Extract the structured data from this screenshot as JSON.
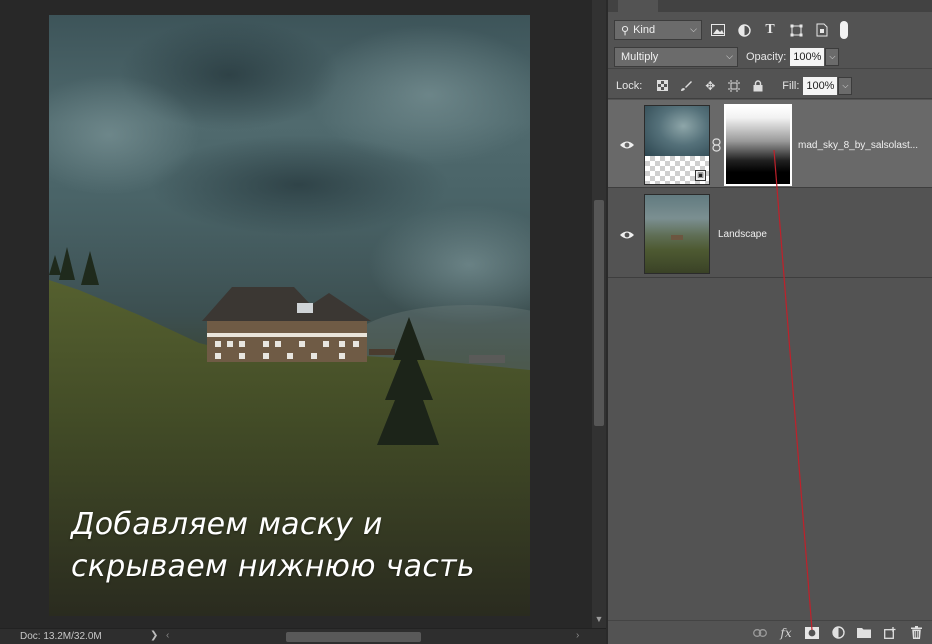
{
  "canvas": {
    "caption_line_1": "Добавляем маску и",
    "caption_line_2": "скрываем нижнюю часть"
  },
  "status_bar": {
    "doc_info": "Doc: 13.2M/32.0M",
    "arrow": "❯"
  },
  "layers_panel": {
    "filter": {
      "kind_label": "Kind",
      "icons": [
        "pixel-filter-icon",
        "adjustment-filter-icon",
        "type-filter-icon",
        "shape-filter-icon",
        "smart-object-filter-icon"
      ]
    },
    "blend_mode": "Multiply",
    "opacity_label": "Opacity:",
    "opacity_value": "100%",
    "lock_label": "Lock:",
    "fill_label": "Fill:",
    "fill_value": "100%",
    "layers": [
      {
        "name": "mad_sky_8_by_salsolast...",
        "visible": true,
        "has_mask": true,
        "selected": true
      },
      {
        "name": "Landscape",
        "visible": true,
        "has_mask": false,
        "selected": false
      }
    ]
  },
  "colors": {
    "panel_bg": "#535353",
    "selected_layer": "#696969",
    "annotation": "#c0202a"
  }
}
